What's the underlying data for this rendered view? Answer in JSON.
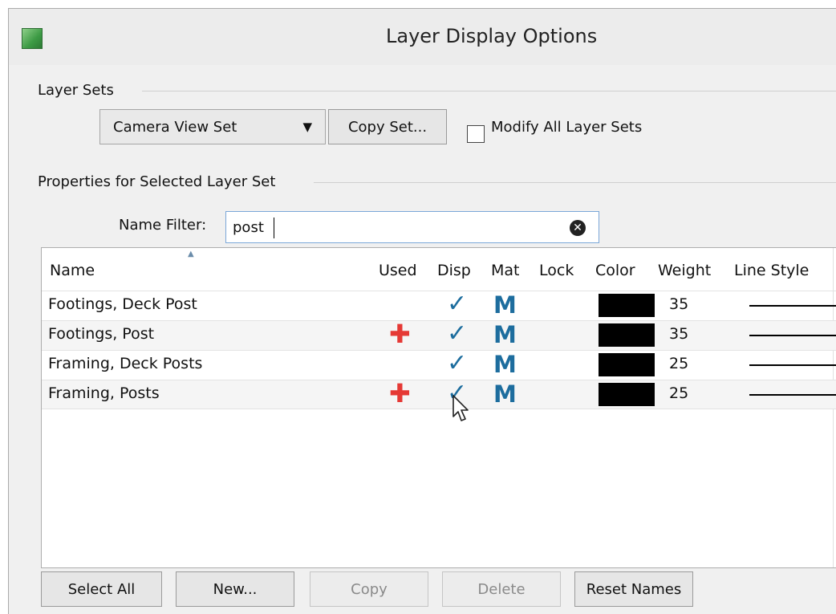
{
  "window": {
    "title": "Layer Display Options"
  },
  "layer_sets": {
    "label": "Layer Sets",
    "selected_set": "Camera View Set",
    "copy_set_label": "Copy Set...",
    "modify_all_label": "Modify All Layer Sets",
    "modify_all_checked": false
  },
  "properties": {
    "label": "Properties for Selected Layer Set",
    "name_filter_label": "Name Filter:",
    "name_filter_value": "post"
  },
  "table": {
    "columns": [
      "Name",
      "Used",
      "Disp",
      "Mat",
      "Lock",
      "Color",
      "Weight",
      "Line Style"
    ],
    "rows": [
      {
        "name": "Footings, Deck Post",
        "used": "",
        "disp": "✓",
        "mat": "M",
        "lock": "",
        "color": "#000000",
        "weight": "35",
        "line_style": "solid"
      },
      {
        "name": "Footings, Post",
        "used": "✚",
        "disp": "✓",
        "mat": "M",
        "lock": "",
        "color": "#000000",
        "weight": "35",
        "line_style": "solid"
      },
      {
        "name": "Framing, Deck Posts",
        "used": "",
        "disp": "✓",
        "mat": "M",
        "lock": "",
        "color": "#000000",
        "weight": "25",
        "line_style": "solid"
      },
      {
        "name": "Framing, Posts",
        "used": "✚",
        "disp": "✓",
        "mat": "M",
        "lock": "",
        "color": "#000000",
        "weight": "25",
        "line_style": "solid"
      }
    ]
  },
  "buttons": {
    "select_all": "Select All",
    "new": "New...",
    "copy": "Copy",
    "delete": "Delete",
    "reset_names": "Reset Names"
  },
  "colors": {
    "used_plus": "#e53935",
    "check": "#1d6d9e",
    "filter_border": "#7aa7d8"
  }
}
